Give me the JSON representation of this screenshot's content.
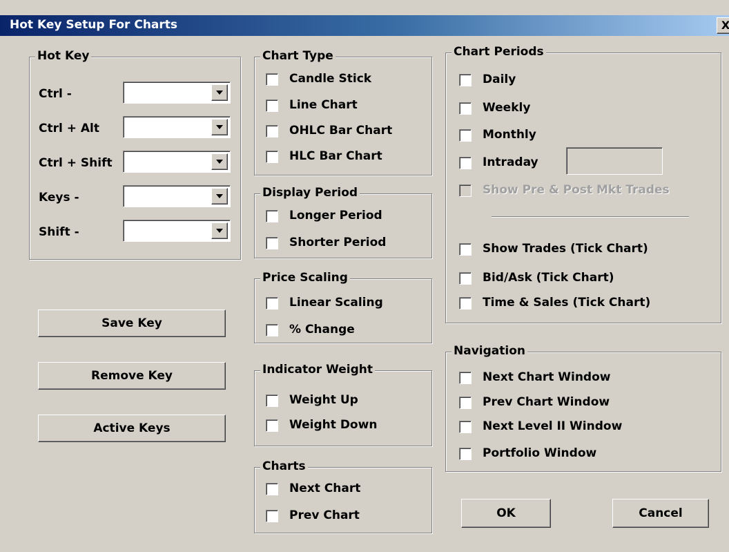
{
  "window": {
    "title": "Hot Key Setup For Charts",
    "close_label": "X"
  },
  "hotkey": {
    "title": "Hot Key",
    "rows": [
      {
        "label": "Ctrl -",
        "value": ""
      },
      {
        "label": "Ctrl + Alt",
        "value": ""
      },
      {
        "label": "Ctrl + Shift",
        "value": ""
      },
      {
        "label": "Keys -",
        "value": ""
      },
      {
        "label": "Shift -",
        "value": ""
      }
    ]
  },
  "buttons": {
    "save": "Save Key",
    "remove": "Remove Key",
    "active": "Active Keys",
    "ok": "OK",
    "cancel": "Cancel"
  },
  "chart_type": {
    "title": "Chart Type",
    "items": [
      "Candle Stick",
      "Line Chart",
      "OHLC Bar Chart",
      "HLC Bar Chart"
    ]
  },
  "display_period": {
    "title": "Display Period",
    "items": [
      "Longer Period",
      "Shorter Period"
    ]
  },
  "price_scaling": {
    "title": "Price Scaling",
    "items": [
      "Linear Scaling",
      "% Change"
    ]
  },
  "indicator_weight": {
    "title": "Indicator Weight",
    "items": [
      "Weight Up",
      "Weight Down"
    ]
  },
  "charts": {
    "title": "Charts",
    "items": [
      "Next Chart",
      "Prev Chart"
    ]
  },
  "chart_periods": {
    "title": "Chart Periods",
    "items": [
      "Daily",
      "Weekly",
      "Monthly",
      "Intraday"
    ],
    "intraday_value": "",
    "disabled_item": "Show Pre & Post Mkt Trades",
    "tick_items": [
      "Show Trades (Tick Chart)",
      "Bid/Ask (Tick Chart)",
      "Time & Sales (Tick Chart)"
    ]
  },
  "navigation": {
    "title": "Navigation",
    "items": [
      "Next Chart Window",
      "Prev Chart Window",
      "Next Level II Window",
      "Portfolio Window"
    ]
  }
}
